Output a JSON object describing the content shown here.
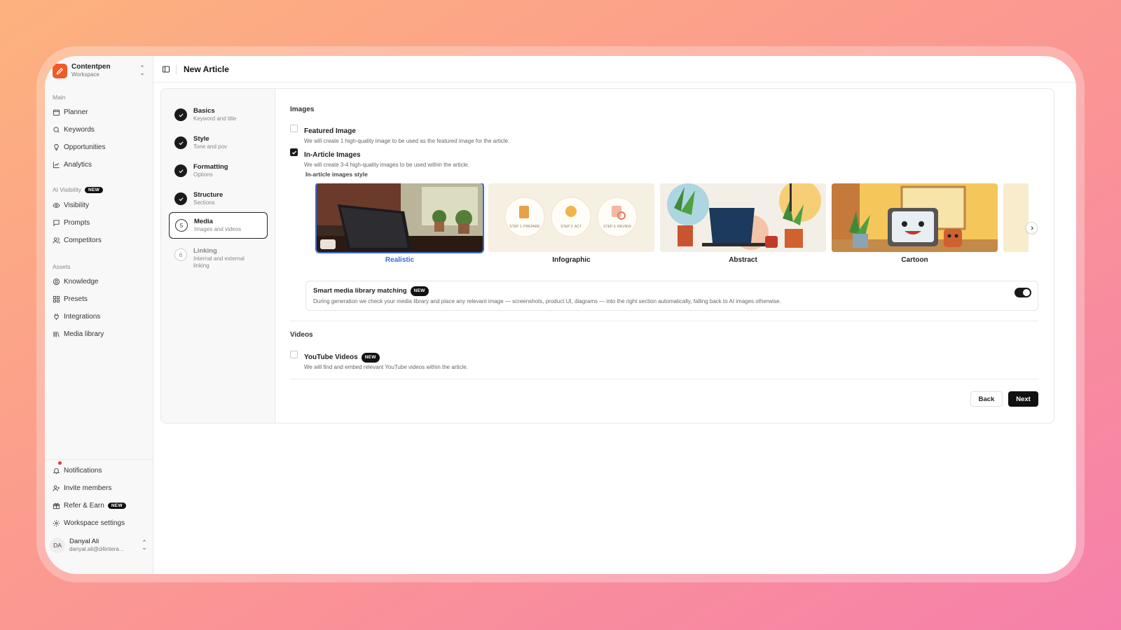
{
  "workspace": {
    "name": "Contentpen",
    "subtitle": "Workspace"
  },
  "sidebar": {
    "main_label": "Main",
    "main_items": [
      {
        "label": "Planner",
        "icon": "calendar-icon"
      },
      {
        "label": "Keywords",
        "icon": "search-icon"
      },
      {
        "label": "Opportunities",
        "icon": "lightbulb-icon"
      },
      {
        "label": "Analytics",
        "icon": "chart-line-icon"
      }
    ],
    "ai_label": "AI Visibility",
    "ai_badge": "NEW",
    "ai_items": [
      {
        "label": "Visibility",
        "icon": "eye-icon"
      },
      {
        "label": "Prompts",
        "icon": "message-icon"
      },
      {
        "label": "Competitors",
        "icon": "users-icon"
      }
    ],
    "assets_label": "Assets",
    "assets_items": [
      {
        "label": "Knowledge",
        "icon": "book-icon"
      },
      {
        "label": "Presets",
        "icon": "grid-icon"
      },
      {
        "label": "Integrations",
        "icon": "plug-icon"
      },
      {
        "label": "Media library",
        "icon": "library-icon"
      }
    ],
    "bottom_items": [
      {
        "label": "Notifications",
        "icon": "bell-icon"
      },
      {
        "label": "Invite members",
        "icon": "user-plus-icon"
      },
      {
        "label": "Refer & Earn",
        "icon": "gift-icon",
        "badge": "NEW"
      },
      {
        "label": "Workspace settings",
        "icon": "gear-icon"
      }
    ],
    "user": {
      "initials": "DA",
      "name": "Danyal Ali",
      "email": "danyal.ali@d4intera..."
    }
  },
  "header": {
    "title": "New Article"
  },
  "steps": [
    {
      "number": "1",
      "title": "Basics",
      "subtitle": "Keyword and title",
      "state": "done"
    },
    {
      "number": "2",
      "title": "Style",
      "subtitle": "Tone and pov",
      "state": "done"
    },
    {
      "number": "3",
      "title": "Formatting",
      "subtitle": "Options",
      "state": "done"
    },
    {
      "number": "4",
      "title": "Structure",
      "subtitle": "Sections",
      "state": "done"
    },
    {
      "number": "5",
      "title": "Media",
      "subtitle": "Images and videos",
      "state": "current"
    },
    {
      "number": "6",
      "title": "Linking",
      "subtitle": "Internal and external linking",
      "state": "todo"
    }
  ],
  "images": {
    "heading": "Images",
    "featured": {
      "title": "Featured Image",
      "description": "We will create 1 high-quality image to be used as the featured image for the article.",
      "checked": false
    },
    "in_article": {
      "title": "In-Article Images",
      "description": "We will create 3-4 high-quality images to be used within the article.",
      "checked": true
    },
    "style_label": "In-article images style",
    "styles": [
      {
        "name": "Realistic",
        "selected": true
      },
      {
        "name": "Infographic",
        "selected": false
      },
      {
        "name": "Abstract",
        "selected": false
      },
      {
        "name": "Cartoon",
        "selected": false
      }
    ],
    "infographic_steps": [
      "STEP 1: PREPARE",
      "STEP 2: ACT",
      "STEP 3: REVIEW"
    ],
    "smart_match": {
      "title": "Smart media library matching",
      "badge": "NEW",
      "description": "During generation we check your media library and place any relevant image — screenshots, product UI, diagrams — into the right section automatically, falling back to AI images otherwise.",
      "enabled": true
    }
  },
  "videos": {
    "heading": "Videos",
    "youtube": {
      "title": "YouTube Videos",
      "badge": "NEW",
      "description": "We will find and embed relevant YouTube videos within the article.",
      "checked": false
    }
  },
  "actions": {
    "back": "Back",
    "next": "Next"
  },
  "colors": {
    "accent": "#3b67d6",
    "brand": "#f25a28",
    "dark": "#111111"
  }
}
